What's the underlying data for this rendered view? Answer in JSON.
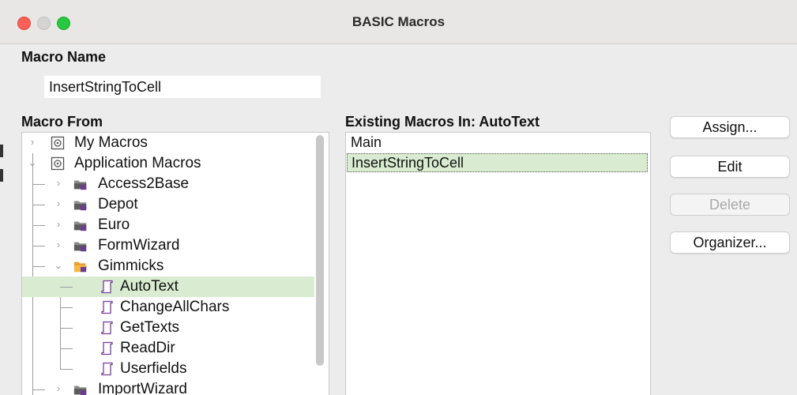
{
  "window": {
    "title": "BASIC Macros"
  },
  "macro_name": {
    "label": "Macro Name",
    "value": "InsertStringToCell"
  },
  "macro_from": {
    "label": "Macro From",
    "tree": [
      {
        "label": "My Macros",
        "icon": "library-icon"
      },
      {
        "label": "Application Macros",
        "icon": "library-icon"
      },
      {
        "label": "Access2Base",
        "icon": "folder-icon"
      },
      {
        "label": "Depot",
        "icon": "folder-icon"
      },
      {
        "label": "Euro",
        "icon": "folder-icon"
      },
      {
        "label": "FormWizard",
        "icon": "folder-icon"
      },
      {
        "label": "Gimmicks",
        "icon": "folder-open-icon"
      },
      {
        "label": "AutoText",
        "icon": "module-icon",
        "selected": true
      },
      {
        "label": "ChangeAllChars",
        "icon": "module-icon"
      },
      {
        "label": "GetTexts",
        "icon": "module-icon"
      },
      {
        "label": "ReadDir",
        "icon": "module-icon"
      },
      {
        "label": "Userfields",
        "icon": "module-icon"
      },
      {
        "label": "ImportWizard",
        "icon": "folder-icon"
      }
    ]
  },
  "existing": {
    "label": "Existing Macros In: AutoText",
    "items": [
      {
        "label": "Main"
      },
      {
        "label": "InsertStringToCell",
        "selected": true
      }
    ]
  },
  "buttons": {
    "assign": "Assign...",
    "edit": "Edit",
    "delete": "Delete",
    "organizer": "Organizer..."
  },
  "colors": {
    "selection": "#d9ecd1",
    "close": "#fe5f57",
    "maximize": "#28c840",
    "folder": "#e8a030",
    "module": "#8a3fb0"
  }
}
